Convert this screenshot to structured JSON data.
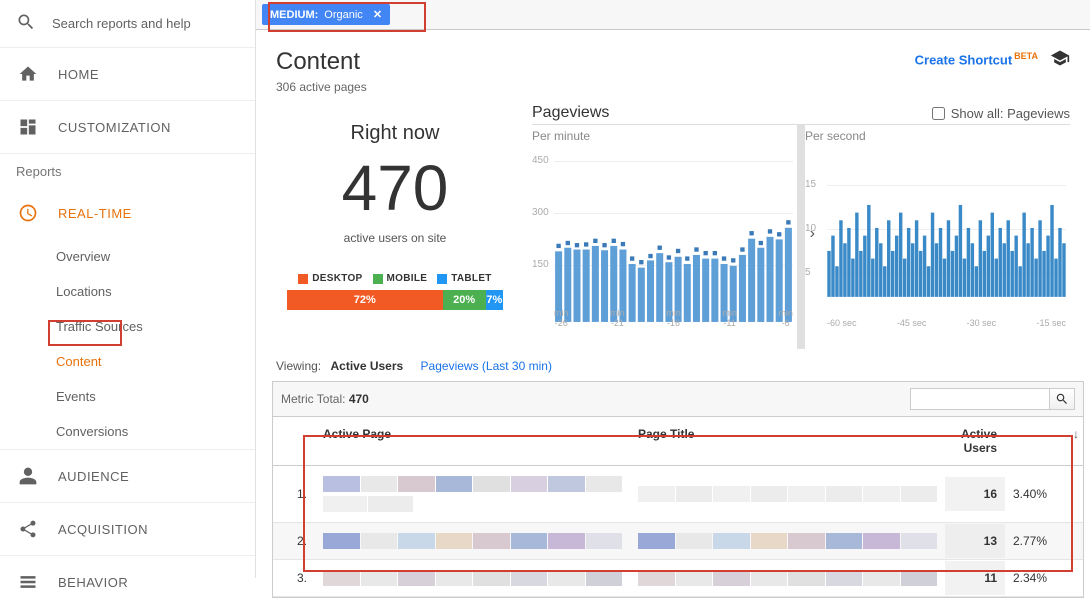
{
  "sidebar": {
    "search_placeholder": "Search reports and help",
    "home": "HOME",
    "customization": "CUSTOMIZATION",
    "reports_label": "Reports",
    "realtime": "REAL-TIME",
    "sub": {
      "overview": "Overview",
      "locations": "Locations",
      "traffic": "Traffic Sources",
      "content": "Content",
      "events": "Events",
      "conversions": "Conversions"
    },
    "audience": "AUDIENCE",
    "acquisition": "ACQUISITION",
    "behavior": "BEHAVIOR"
  },
  "filter": {
    "label": "MEDIUM:",
    "value": "Organic",
    "close": "✕"
  },
  "header": {
    "title": "Content",
    "subtitle": "306 active pages",
    "create_shortcut": "Create Shortcut",
    "beta": "BETA"
  },
  "right_now": {
    "label": "Right now",
    "value": "470",
    "sub": "active users on site",
    "legend": {
      "desktop": "DESKTOP",
      "mobile": "MOBILE",
      "tablet": "TABLET"
    },
    "bars": {
      "desktop_pct": "72%",
      "mobile_pct": "20%",
      "tablet_pct": "7%"
    }
  },
  "pageviews": {
    "title": "Pageviews",
    "show_all_label": "Show all: Pageviews",
    "per_minute_label": "Per minute",
    "per_second_label": "Per second"
  },
  "chart_data": [
    {
      "type": "bar",
      "title": "Per minute",
      "xlabel": "min",
      "ylabel": "",
      "ylim": [
        0,
        450
      ],
      "categories": [
        "-26",
        "-25",
        "-24",
        "-23",
        "-22",
        "-21",
        "-20",
        "-19",
        "-18",
        "-17",
        "-16",
        "-15",
        "-14",
        "-13",
        "-12",
        "-11",
        "-10",
        "-9",
        "-8",
        "-7",
        "-6",
        "-5",
        "-4",
        "-3",
        "-2",
        "-1"
      ],
      "series": [
        {
          "name": "pageviews",
          "values": [
            195,
            205,
            200,
            200,
            210,
            198,
            210,
            200,
            160,
            150,
            170,
            190,
            165,
            180,
            160,
            185,
            175,
            175,
            160,
            155,
            185,
            230,
            205,
            235,
            228,
            260
          ]
        },
        {
          "name": "line",
          "values": [
            210,
            218,
            212,
            214,
            224,
            212,
            224,
            215,
            175,
            165,
            182,
            205,
            178,
            196,
            175,
            200,
            190,
            190,
            175,
            170,
            200,
            245,
            218,
            250,
            242,
            275
          ]
        }
      ],
      "x_tick_labels": [
        "min\n-26",
        "min\n-21",
        "min\n-16",
        "min\n-11",
        "min\n-6"
      ]
    },
    {
      "type": "bar",
      "title": "Per second",
      "xlabel": "sec",
      "ylabel": "",
      "ylim": [
        0,
        18
      ],
      "categories_range": "-60..-1",
      "values": [
        6,
        8,
        4,
        10,
        7,
        9,
        5,
        11,
        6,
        8,
        12,
        5,
        9,
        7,
        4,
        10,
        6,
        8,
        11,
        5,
        9,
        7,
        10,
        6,
        8,
        4,
        11,
        7,
        9,
        5,
        10,
        6,
        8,
        12,
        5,
        9,
        7,
        4,
        10,
        6,
        8,
        11,
        5,
        9,
        7,
        10,
        6,
        8,
        4,
        11,
        7,
        9,
        5,
        10,
        6,
        8,
        12,
        5,
        9,
        7
      ],
      "x_tick_labels": [
        "-60 sec",
        "-45 sec",
        "-30 sec",
        "-15 sec"
      ]
    }
  ],
  "viewing": {
    "label": "Viewing:",
    "active": "Active Users",
    "inactive": "Pageviews (Last 30 min)"
  },
  "metric": {
    "label": "Metric Total:",
    "value": "470"
  },
  "table": {
    "headers": {
      "active_page": "Active Page",
      "page_title": "Page Title",
      "active_users": "Active Users"
    },
    "rows": [
      {
        "idx": "1.",
        "au": "16",
        "pct": "3.40%"
      },
      {
        "idx": "2.",
        "au": "13",
        "pct": "2.77%"
      },
      {
        "idx": "3.",
        "au": "11",
        "pct": "2.34%"
      }
    ]
  }
}
